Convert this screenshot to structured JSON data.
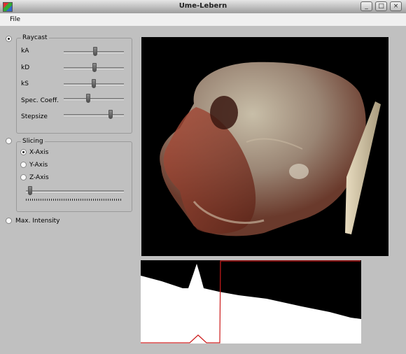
{
  "window": {
    "title": "Ume-Lebern",
    "min_label": "_",
    "max_label": "□",
    "close_label": "×"
  },
  "menu": {
    "file": "File"
  },
  "modes": {
    "raycast": {
      "label": "Raycast",
      "selected": true,
      "sliders": [
        {
          "label": "kA",
          "value": 0.52
        },
        {
          "label": "kD",
          "value": 0.51
        },
        {
          "label": "kS",
          "value": 0.5
        },
        {
          "label": "Spec. Coeff.",
          "value": 0.4
        },
        {
          "label": "Stepsize",
          "value": 0.8
        }
      ]
    },
    "slicing": {
      "label": "Slicing",
      "selected": false,
      "axes": [
        {
          "label": "X-Axis",
          "selected": true
        },
        {
          "label": "Y-Axis",
          "selected": false
        },
        {
          "label": "Z-Axis",
          "selected": false
        }
      ],
      "slice_position": 0.0
    },
    "max_intensity": {
      "label": "Max. Intensity",
      "selected": false
    }
  },
  "colors": {
    "transfer_curve": "#cc1b1b",
    "bone": "#c8bea8",
    "tissue": "#b0503c"
  }
}
